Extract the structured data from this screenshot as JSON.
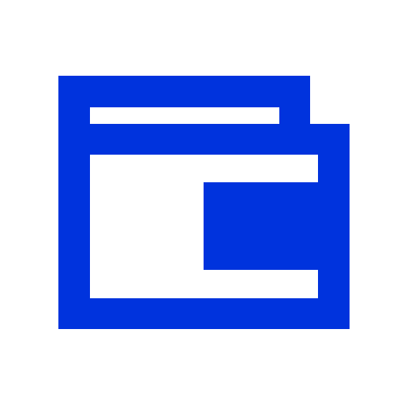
{
  "icon": {
    "name": "wallet-icon",
    "color": "#0033DD",
    "background": "#FFFFFF"
  }
}
